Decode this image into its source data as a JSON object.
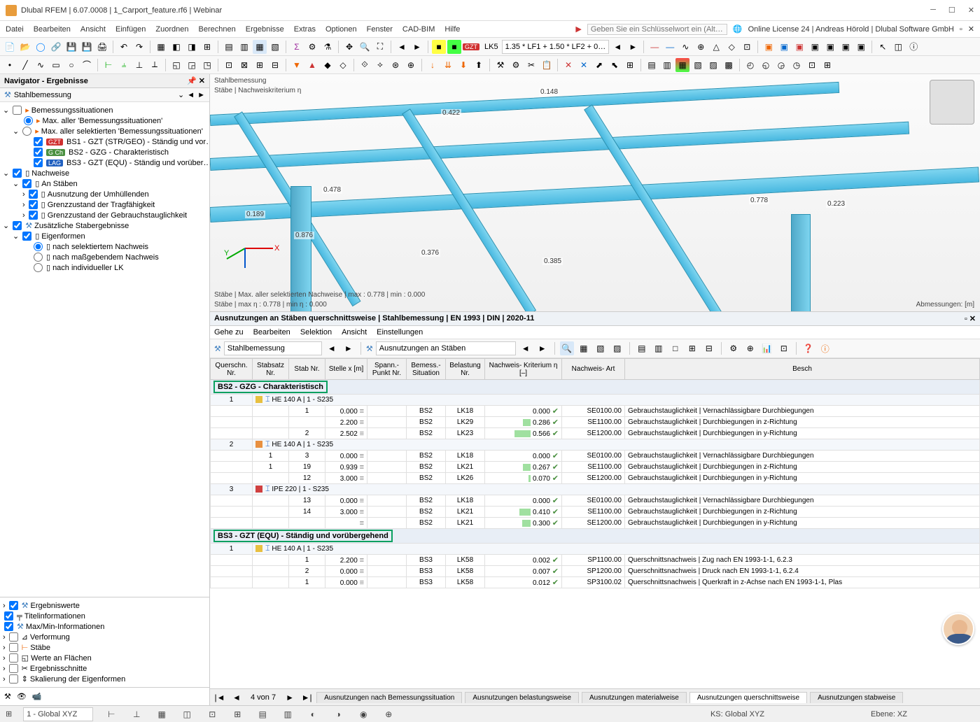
{
  "window": {
    "title": "Dlubal RFEM | 6.07.0008 | 1_Carport_feature.rf6 | Webinar",
    "online": "Online License 24 | Andreas Hörold | Dlubal Software GmbH"
  },
  "menu": [
    "Datei",
    "Bearbeiten",
    "Ansicht",
    "Einfügen",
    "Zuordnen",
    "Berechnen",
    "Ergebnisse",
    "Extras",
    "Optionen",
    "Fenster",
    "CAD-BIM",
    "Hilfe"
  ],
  "search_placeholder": "Geben Sie ein Schlüsselwort ein (Alt…",
  "toolbar_combo1": "LK5",
  "toolbar_combo2": "1.35 * LF1 + 1.50 * LF2 + 0…",
  "navigator": {
    "title": "Navigator - Ergebnisse",
    "mode": "Stahlbemessung",
    "root1": "Bemessungssituationen",
    "opt_max_all": "Max. aller 'Bemessungssituationen'",
    "opt_max_sel": "Max. aller selektierten 'Bemessungssituationen'",
    "bs1": "BS1 - GZT (STR/GEO) - Ständig und vor…",
    "bs2": "BS2 - GZG - Charakteristisch",
    "bs3": "BS3 - GZT (EQU) - Ständig und vorüber…",
    "nachweise": "Nachweise",
    "anstaeben": "An Stäben",
    "ausn": "Ausnutzung der Umhüllenden",
    "grenz_trag": "Grenzzustand der Tragfähigkeit",
    "grenz_gebr": "Grenzzustand der Gebrauchstauglichkeit",
    "zus": "Zusätzliche Stabergebnisse",
    "eigen": "Eigenformen",
    "eigen1": "nach selektiertem Nachweis",
    "eigen2": "nach maßgebendem Nachweis",
    "eigen3": "nach individueller LK",
    "bottom": [
      "Ergebniswerte",
      "Titelinformationen",
      "Max/Min-Informationen",
      "Verformung",
      "Stäbe",
      "Werte an Flächen",
      "Ergebnisschnitte",
      "Skalierung der Eigenformen"
    ]
  },
  "view": {
    "title1": "Stahlbemessung",
    "title2": "Stäbe | Nachweiskriterium η",
    "footer1": "Stäbe | Max. aller selektierten Nachweise | max  : 0.778 | min  : 0.000",
    "footer2": "Stäbe | max η : 0.778 | min η : 0.000",
    "dim_label": "Abmessungen: [m]",
    "values": [
      "0.148",
      "0.422",
      "0.778",
      "0.223",
      "0.189",
      "0.876",
      "0.376",
      "0.385",
      "0.478"
    ]
  },
  "panel": {
    "title": "Ausnutzungen an Stäben querschnittsweise | Stahlbemessung | EN 1993 | DIN | 2020-11",
    "menu": [
      "Gehe zu",
      "Bearbeiten",
      "Selektion",
      "Ansicht",
      "Einstellungen"
    ],
    "combo1": "Stahlbemessung",
    "combo2": "Ausnutzungen an Stäben",
    "headers": [
      "Querschn.\nNr.",
      "Stabsatz\nNr.",
      "Stab\nNr.",
      "Stelle\nx [m]",
      "Spann.-\nPunkt Nr.",
      "Bemess.-\nSituation",
      "Belastung\nNr.",
      "Nachweis-\nKriterium η [–]",
      "Nachweis-\nArt",
      "Besch"
    ],
    "group1": "BS2 - GZG - Charakteristisch",
    "group2": "BS3 - GZT (EQU) - Ständig und vorübergehend",
    "sect1": "HE 140 A | 1 - S235",
    "sect2": "HE 140 A | 1 - S235",
    "sect3": "IPE 220 | 1 - S235",
    "sect4": "HE 140 A | 1 - S235",
    "rows": [
      {
        "q": "1",
        "ss": "",
        "st": "1",
        "x": "0.000",
        "sit": "BS2",
        "lk": "LK18",
        "eta": "0.000",
        "code": "SE0100.00",
        "desc": "Gebrauchstauglichkeit | Vernachlässigbare Durchbiegungen"
      },
      {
        "q": "",
        "ss": "",
        "st": "",
        "x": "2.200",
        "sit": "BS2",
        "lk": "LK29",
        "eta": "0.286",
        "code": "SE1100.00",
        "desc": "Gebrauchstauglichkeit | Durchbiegungen in z-Richtung"
      },
      {
        "q": "",
        "ss": "",
        "st": "2",
        "x": "2.502",
        "sit": "BS2",
        "lk": "LK23",
        "eta": "0.566",
        "code": "SE1200.00",
        "desc": "Gebrauchstauglichkeit | Durchbiegungen in y-Richtung"
      },
      {
        "q": "2",
        "ss": "1",
        "st": "3",
        "x": "0.000",
        "sit": "BS2",
        "lk": "LK18",
        "eta": "0.000",
        "code": "SE0100.00",
        "desc": "Gebrauchstauglichkeit | Vernachlässigbare Durchbiegungen"
      },
      {
        "q": "",
        "ss": "1",
        "st": "19",
        "x": "0.939",
        "sit": "BS2",
        "lk": "LK21",
        "eta": "0.267",
        "code": "SE1100.00",
        "desc": "Gebrauchstauglichkeit | Durchbiegungen in z-Richtung"
      },
      {
        "q": "",
        "ss": "",
        "st": "12",
        "x": "3.000",
        "sit": "BS2",
        "lk": "LK26",
        "eta": "0.070",
        "code": "SE1200.00",
        "desc": "Gebrauchstauglichkeit | Durchbiegungen in y-Richtung"
      },
      {
        "q": "3",
        "ss": "",
        "st": "13",
        "x": "0.000",
        "sit": "BS2",
        "lk": "LK18",
        "eta": "0.000",
        "code": "SE0100.00",
        "desc": "Gebrauchstauglichkeit | Vernachlässigbare Durchbiegungen"
      },
      {
        "q": "",
        "ss": "",
        "st": "14",
        "x": "3.000",
        "sit": "BS2",
        "lk": "LK21",
        "eta": "0.410",
        "code": "SE1100.00",
        "desc": "Gebrauchstauglichkeit | Durchbiegungen in z-Richtung"
      },
      {
        "q": "",
        "ss": "",
        "st": "",
        "x": "",
        "sit": "BS2",
        "lk": "LK21",
        "eta": "0.300",
        "code": "SE1200.00",
        "desc": "Gebrauchstauglichkeit | Durchbiegungen in y-Richtung"
      },
      {
        "q": "1",
        "ss": "",
        "st": "1",
        "x": "2.200",
        "sit": "BS3",
        "lk": "LK58",
        "eta": "0.002",
        "code": "SP1100.00",
        "desc": "Querschnittsnachweis | Zug nach EN 1993-1-1, 6.2.3"
      },
      {
        "q": "",
        "ss": "",
        "st": "2",
        "x": "0.000",
        "sit": "BS3",
        "lk": "LK58",
        "eta": "0.007",
        "code": "SP1200.00",
        "desc": "Querschnittsnachweis | Druck nach EN 1993-1-1, 6.2.4"
      },
      {
        "q": "",
        "ss": "",
        "st": "1",
        "x": "0.000",
        "sit": "BS3",
        "lk": "LK58",
        "eta": "0.012",
        "code": "SP3100.02",
        "desc": "Querschnittsnachweis | Querkraft in z-Achse nach EN 1993-1-1,   Plas"
      }
    ],
    "pager": "4 von 7",
    "tabs": [
      "Ausnutzungen nach Bemessungssituation",
      "Ausnutzungen belastungsweise",
      "Ausnutzungen materialweise",
      "Ausnutzungen querschnittsweise",
      "Ausnutzungen stabweise"
    ]
  },
  "status": {
    "ks": "KS: Global XYZ",
    "ebene": "Ebene: XZ",
    "cs": "1 - Global XYZ"
  }
}
